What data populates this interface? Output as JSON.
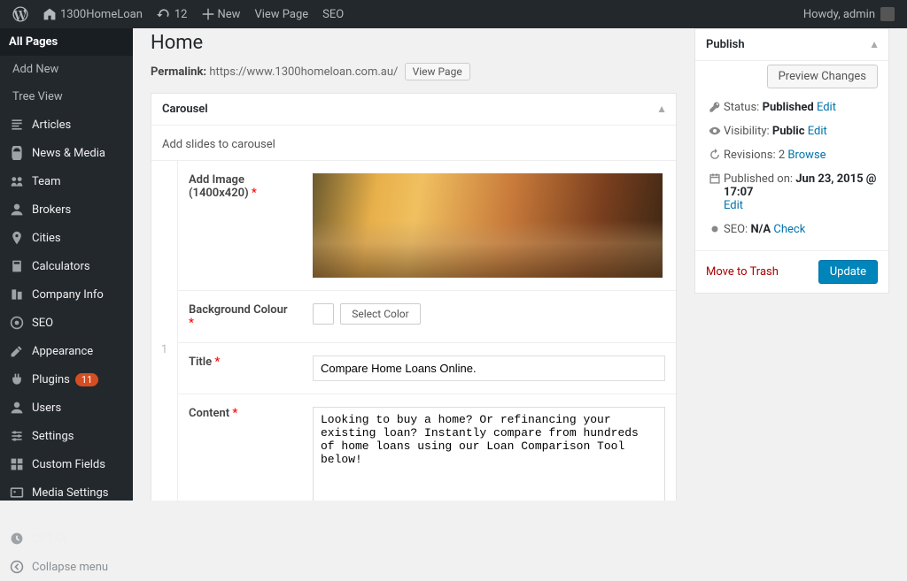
{
  "adminbar": {
    "site_name": "1300HomeLoan",
    "updates_count": "12",
    "new_label": "New",
    "view_page_label": "View Page",
    "seo_label": "SEO",
    "howdy": "Howdy, admin"
  },
  "sidebar": {
    "all_pages": "All Pages",
    "add_new": "Add New",
    "tree_view": "Tree View",
    "items": [
      {
        "label": "Articles"
      },
      {
        "label": "News & Media"
      },
      {
        "label": "Team"
      },
      {
        "label": "Brokers"
      },
      {
        "label": "Cities"
      },
      {
        "label": "Calculators"
      },
      {
        "label": "Company Info"
      },
      {
        "label": "SEO"
      },
      {
        "label": "Appearance"
      },
      {
        "label": "Plugins",
        "badge": "11"
      },
      {
        "label": "Users"
      },
      {
        "label": "Settings"
      },
      {
        "label": "Custom Fields"
      },
      {
        "label": "Media Settings"
      }
    ],
    "cpt_ui": "CPT UI",
    "collapse": "Collapse menu"
  },
  "page": {
    "title": "Home",
    "permalink_label": "Permalink:",
    "permalink_url": "https://www.1300homeloan.com.au/",
    "view_page_btn": "View Page"
  },
  "carousel": {
    "box_title": "Carousel",
    "desc": "Add slides to carousel",
    "row_number": "1",
    "fields": {
      "add_image_label": "Add Image (1400x420)",
      "bg_colour_label": "Background Colour",
      "select_color_btn": "Select Color",
      "title_label": "Title",
      "title_value": "Compare Home Loans Online.",
      "content_label": "Content",
      "content_value": "Looking to buy a home? Or refinancing your existing loan? Instantly compare from hundreds of home loans using our Loan Comparison Tool below!"
    }
  },
  "publish": {
    "box_title": "Publish",
    "preview_btn": "Preview Changes",
    "status_label": "Status:",
    "status_value": "Published",
    "visibility_label": "Visibility:",
    "visibility_value": "Public",
    "revisions_label": "Revisions:",
    "revisions_value": "2",
    "published_on_label": "Published on:",
    "published_on_value": "Jun 23, 2015 @ 17:07",
    "seo_label": "SEO:",
    "seo_value": "N/A",
    "edit_link": "Edit",
    "browse_link": "Browse",
    "check_link": "Check",
    "trash_label": "Move to Trash",
    "update_btn": "Update"
  }
}
